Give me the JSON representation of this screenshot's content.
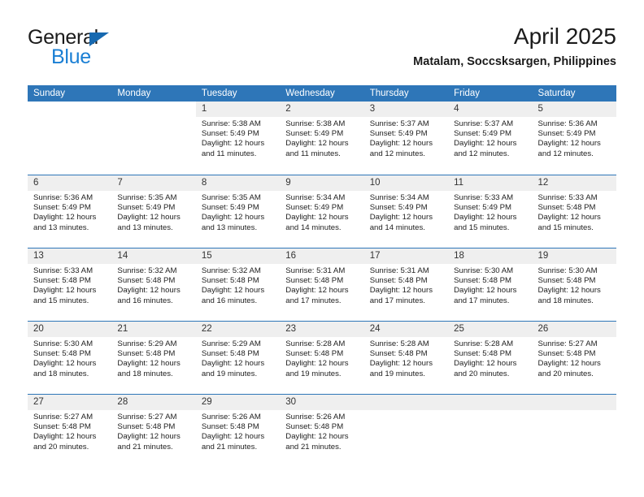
{
  "brand": {
    "name_part1": "General",
    "name_part2": "Blue"
  },
  "header": {
    "title": "April 2025",
    "subtitle": "Matalam, Soccsksargen, Philippines"
  },
  "colors": {
    "header_blue": "#2e76b8",
    "logo_blue": "#1a7fd4",
    "day_band": "#efefef"
  },
  "weekdays": [
    "Sunday",
    "Monday",
    "Tuesday",
    "Wednesday",
    "Thursday",
    "Friday",
    "Saturday"
  ],
  "weeks": [
    [
      {
        "blank": true
      },
      {
        "blank": true
      },
      {
        "day": "1",
        "sunrise": "Sunrise: 5:38 AM",
        "sunset": "Sunset: 5:49 PM",
        "daylight1": "Daylight: 12 hours",
        "daylight2": "and 11 minutes."
      },
      {
        "day": "2",
        "sunrise": "Sunrise: 5:38 AM",
        "sunset": "Sunset: 5:49 PM",
        "daylight1": "Daylight: 12 hours",
        "daylight2": "and 11 minutes."
      },
      {
        "day": "3",
        "sunrise": "Sunrise: 5:37 AM",
        "sunset": "Sunset: 5:49 PM",
        "daylight1": "Daylight: 12 hours",
        "daylight2": "and 12 minutes."
      },
      {
        "day": "4",
        "sunrise": "Sunrise: 5:37 AM",
        "sunset": "Sunset: 5:49 PM",
        "daylight1": "Daylight: 12 hours",
        "daylight2": "and 12 minutes."
      },
      {
        "day": "5",
        "sunrise": "Sunrise: 5:36 AM",
        "sunset": "Sunset: 5:49 PM",
        "daylight1": "Daylight: 12 hours",
        "daylight2": "and 12 minutes."
      }
    ],
    [
      {
        "day": "6",
        "sunrise": "Sunrise: 5:36 AM",
        "sunset": "Sunset: 5:49 PM",
        "daylight1": "Daylight: 12 hours",
        "daylight2": "and 13 minutes."
      },
      {
        "day": "7",
        "sunrise": "Sunrise: 5:35 AM",
        "sunset": "Sunset: 5:49 PM",
        "daylight1": "Daylight: 12 hours",
        "daylight2": "and 13 minutes."
      },
      {
        "day": "8",
        "sunrise": "Sunrise: 5:35 AM",
        "sunset": "Sunset: 5:49 PM",
        "daylight1": "Daylight: 12 hours",
        "daylight2": "and 13 minutes."
      },
      {
        "day": "9",
        "sunrise": "Sunrise: 5:34 AM",
        "sunset": "Sunset: 5:49 PM",
        "daylight1": "Daylight: 12 hours",
        "daylight2": "and 14 minutes."
      },
      {
        "day": "10",
        "sunrise": "Sunrise: 5:34 AM",
        "sunset": "Sunset: 5:49 PM",
        "daylight1": "Daylight: 12 hours",
        "daylight2": "and 14 minutes."
      },
      {
        "day": "11",
        "sunrise": "Sunrise: 5:33 AM",
        "sunset": "Sunset: 5:49 PM",
        "daylight1": "Daylight: 12 hours",
        "daylight2": "and 15 minutes."
      },
      {
        "day": "12",
        "sunrise": "Sunrise: 5:33 AM",
        "sunset": "Sunset: 5:48 PM",
        "daylight1": "Daylight: 12 hours",
        "daylight2": "and 15 minutes."
      }
    ],
    [
      {
        "day": "13",
        "sunrise": "Sunrise: 5:33 AM",
        "sunset": "Sunset: 5:48 PM",
        "daylight1": "Daylight: 12 hours",
        "daylight2": "and 15 minutes."
      },
      {
        "day": "14",
        "sunrise": "Sunrise: 5:32 AM",
        "sunset": "Sunset: 5:48 PM",
        "daylight1": "Daylight: 12 hours",
        "daylight2": "and 16 minutes."
      },
      {
        "day": "15",
        "sunrise": "Sunrise: 5:32 AM",
        "sunset": "Sunset: 5:48 PM",
        "daylight1": "Daylight: 12 hours",
        "daylight2": "and 16 minutes."
      },
      {
        "day": "16",
        "sunrise": "Sunrise: 5:31 AM",
        "sunset": "Sunset: 5:48 PM",
        "daylight1": "Daylight: 12 hours",
        "daylight2": "and 17 minutes."
      },
      {
        "day": "17",
        "sunrise": "Sunrise: 5:31 AM",
        "sunset": "Sunset: 5:48 PM",
        "daylight1": "Daylight: 12 hours",
        "daylight2": "and 17 minutes."
      },
      {
        "day": "18",
        "sunrise": "Sunrise: 5:30 AM",
        "sunset": "Sunset: 5:48 PM",
        "daylight1": "Daylight: 12 hours",
        "daylight2": "and 17 minutes."
      },
      {
        "day": "19",
        "sunrise": "Sunrise: 5:30 AM",
        "sunset": "Sunset: 5:48 PM",
        "daylight1": "Daylight: 12 hours",
        "daylight2": "and 18 minutes."
      }
    ],
    [
      {
        "day": "20",
        "sunrise": "Sunrise: 5:30 AM",
        "sunset": "Sunset: 5:48 PM",
        "daylight1": "Daylight: 12 hours",
        "daylight2": "and 18 minutes."
      },
      {
        "day": "21",
        "sunrise": "Sunrise: 5:29 AM",
        "sunset": "Sunset: 5:48 PM",
        "daylight1": "Daylight: 12 hours",
        "daylight2": "and 18 minutes."
      },
      {
        "day": "22",
        "sunrise": "Sunrise: 5:29 AM",
        "sunset": "Sunset: 5:48 PM",
        "daylight1": "Daylight: 12 hours",
        "daylight2": "and 19 minutes."
      },
      {
        "day": "23",
        "sunrise": "Sunrise: 5:28 AM",
        "sunset": "Sunset: 5:48 PM",
        "daylight1": "Daylight: 12 hours",
        "daylight2": "and 19 minutes."
      },
      {
        "day": "24",
        "sunrise": "Sunrise: 5:28 AM",
        "sunset": "Sunset: 5:48 PM",
        "daylight1": "Daylight: 12 hours",
        "daylight2": "and 19 minutes."
      },
      {
        "day": "25",
        "sunrise": "Sunrise: 5:28 AM",
        "sunset": "Sunset: 5:48 PM",
        "daylight1": "Daylight: 12 hours",
        "daylight2": "and 20 minutes."
      },
      {
        "day": "26",
        "sunrise": "Sunrise: 5:27 AM",
        "sunset": "Sunset: 5:48 PM",
        "daylight1": "Daylight: 12 hours",
        "daylight2": "and 20 minutes."
      }
    ],
    [
      {
        "day": "27",
        "sunrise": "Sunrise: 5:27 AM",
        "sunset": "Sunset: 5:48 PM",
        "daylight1": "Daylight: 12 hours",
        "daylight2": "and 20 minutes."
      },
      {
        "day": "28",
        "sunrise": "Sunrise: 5:27 AM",
        "sunset": "Sunset: 5:48 PM",
        "daylight1": "Daylight: 12 hours",
        "daylight2": "and 21 minutes."
      },
      {
        "day": "29",
        "sunrise": "Sunrise: 5:26 AM",
        "sunset": "Sunset: 5:48 PM",
        "daylight1": "Daylight: 12 hours",
        "daylight2": "and 21 minutes."
      },
      {
        "day": "30",
        "sunrise": "Sunrise: 5:26 AM",
        "sunset": "Sunset: 5:48 PM",
        "daylight1": "Daylight: 12 hours",
        "daylight2": "and 21 minutes."
      },
      {
        "empty": true
      },
      {
        "empty": true
      },
      {
        "empty": true
      }
    ]
  ]
}
